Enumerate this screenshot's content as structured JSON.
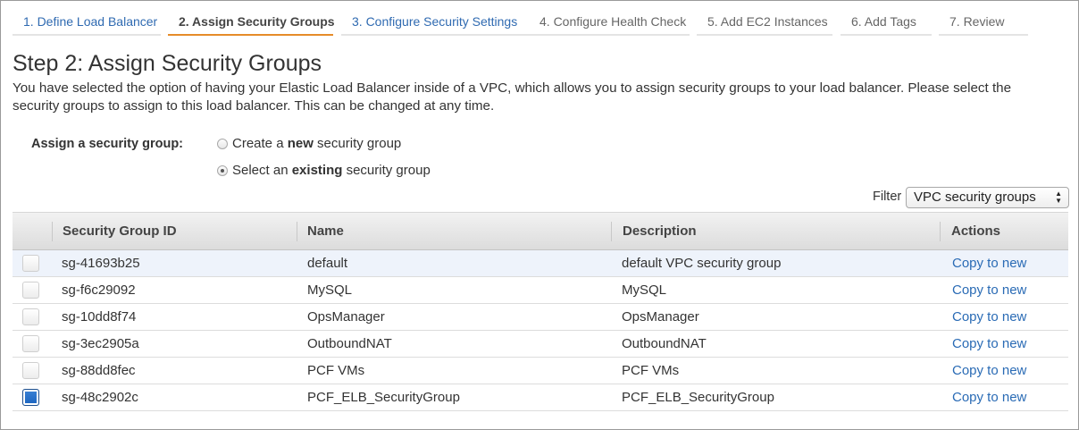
{
  "wizard": {
    "tabs": [
      {
        "label": "1. Define Load Balancer",
        "state": "done"
      },
      {
        "label": "2. Assign Security Groups",
        "state": "active"
      },
      {
        "label": "3. Configure Security Settings",
        "state": "done"
      },
      {
        "label": "4. Configure Health Check",
        "state": "pending"
      },
      {
        "label": "5. Add EC2 Instances",
        "state": "pending"
      },
      {
        "label": "6. Add Tags",
        "state": "pending"
      },
      {
        "label": "7. Review",
        "state": "pending"
      }
    ]
  },
  "page": {
    "title": "Step 2: Assign Security Groups",
    "intro": "You have selected the option of having your Elastic Load Balancer inside of a VPC, which allows you to assign security groups to your load balancer. Please select the security groups to assign to this load balancer. This can be changed at any time."
  },
  "assign": {
    "label": "Assign a security group:",
    "option_create": {
      "pre": "Create a ",
      "bold": "new",
      "post": " security group",
      "selected": false
    },
    "option_existing": {
      "pre": "Select an ",
      "bold": "existing",
      "post": " security group",
      "selected": true
    }
  },
  "filter": {
    "label": "Filter",
    "value": "VPC security groups"
  },
  "table": {
    "headers": {
      "id": "Security Group ID",
      "name": "Name",
      "description": "Description",
      "actions": "Actions"
    },
    "rows": [
      {
        "id": "sg-41693b25",
        "name": "default",
        "description": "default VPC security group",
        "action": "Copy to new",
        "checked": false
      },
      {
        "id": "sg-f6c29092",
        "name": "MySQL",
        "description": "MySQL",
        "action": "Copy to new",
        "checked": false
      },
      {
        "id": "sg-10dd8f74",
        "name": "OpsManager",
        "description": "OpsManager",
        "action": "Copy to new",
        "checked": false
      },
      {
        "id": "sg-3ec2905a",
        "name": "OutboundNAT",
        "description": "OutboundNAT",
        "action": "Copy to new",
        "checked": false
      },
      {
        "id": "sg-88dd8fec",
        "name": "PCF VMs",
        "description": "PCF VMs",
        "action": "Copy to new",
        "checked": false
      },
      {
        "id": "sg-48c2902c",
        "name": "PCF_ELB_SecurityGroup",
        "description": "PCF_ELB_SecurityGroup",
        "action": "Copy to new",
        "checked": true
      }
    ]
  },
  "colors": {
    "link": "#2a6bb5",
    "active_tab_underline": "#e68c2a",
    "checkbox_checked": "#1a63bf"
  }
}
